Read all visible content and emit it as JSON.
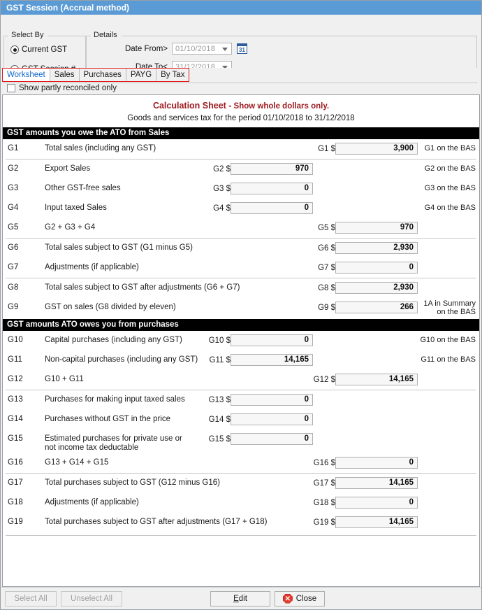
{
  "window": {
    "title": "GST Session (Accrual method)"
  },
  "select_by": {
    "legend": "Select By",
    "options": [
      {
        "label": "Current GST",
        "selected": true
      },
      {
        "label": "GST Session #",
        "selected": false
      }
    ]
  },
  "details": {
    "legend": "Details",
    "date_from": {
      "label": "Date From>",
      "value": "01/10/2018"
    },
    "date_to": {
      "label": "Date To<",
      "value": "31/12/2018"
    },
    "calendar_icon_text": "31"
  },
  "tabs": [
    {
      "label": "Worksheet",
      "active": true
    },
    {
      "label": "Sales",
      "active": false
    },
    {
      "label": "Purchases",
      "active": false
    },
    {
      "label": "PAYG",
      "active": false
    },
    {
      "label": "By Tax",
      "active": false
    }
  ],
  "filter": {
    "checkbox_label": "Show partly reconciled only",
    "checked": false
  },
  "sheet": {
    "title": "Calculation Sheet -",
    "title_note": "Show whole dollars only.",
    "subtitle": "Goods and services tax for the period 01/10/2018 to 31/12/2018",
    "section_sales": "GST amounts you owe the ATO from Sales",
    "section_purchases": "GST amounts ATO owes you from purchases"
  },
  "rows": {
    "g1": {
      "code": "G1",
      "desc": "Total sales (including any GST)",
      "field_label": "G1 $",
      "value": "3,900",
      "note": "G1 on the BAS"
    },
    "g2": {
      "code": "G2",
      "desc": "Export Sales",
      "field_label": "G2 $",
      "value": "970",
      "note": "G2 on the BAS"
    },
    "g3": {
      "code": "G3",
      "desc": "Other GST-free sales",
      "field_label": "G3 $",
      "value": "0",
      "note": "G3 on the BAS"
    },
    "g4": {
      "code": "G4",
      "desc": "Input taxed Sales",
      "field_label": "G4 $",
      "value": "0",
      "note": "G4 on the BAS"
    },
    "g5": {
      "code": "G5",
      "desc": "G2 + G3 + G4",
      "field_label": "G5 $",
      "value": "970",
      "note": ""
    },
    "g6": {
      "code": "G6",
      "desc": "Total sales subject to GST (G1 minus G5)",
      "field_label": "G6 $",
      "value": "2,930",
      "note": ""
    },
    "g7": {
      "code": "G7",
      "desc": "Adjustments (if applicable)",
      "field_label": "G7 $",
      "value": "0",
      "note": ""
    },
    "g8": {
      "code": "G8",
      "desc": "Total sales subject to GST after adjustments (G6 + G7)",
      "field_label": "G8 $",
      "value": "2,930",
      "note": ""
    },
    "g9": {
      "code": "G9",
      "desc": "GST on sales (G8 divided by eleven)",
      "field_label": "G9 $",
      "value": "266",
      "note": "1A in Summary\non the BAS"
    },
    "g10": {
      "code": "G10",
      "desc": "Capital purchases (including any GST)",
      "field_label": "G10 $",
      "value": "0",
      "note": "G10 on the BAS"
    },
    "g11": {
      "code": "G11",
      "desc": "Non-capital purchases (including any GST)",
      "field_label": "G11 $",
      "value": "14,165",
      "note": "G11 on the BAS"
    },
    "g12": {
      "code": "G12",
      "desc": "G10 + G11",
      "field_label": "G12 $",
      "value": "14,165",
      "note": ""
    },
    "g13": {
      "code": "G13",
      "desc": "Purchases for making input taxed sales",
      "field_label": "G13 $",
      "value": "0",
      "note": ""
    },
    "g14": {
      "code": "G14",
      "desc": "Purchases without GST in the price",
      "field_label": "G14 $",
      "value": "0",
      "note": ""
    },
    "g15": {
      "code": "G15",
      "desc": "Estimated purchases for private use or\nnot income tax deductable",
      "field_label": "G15 $",
      "value": "0",
      "note": ""
    },
    "g16": {
      "code": "G16",
      "desc": "G13 + G14 + G15",
      "field_label": "G16 $",
      "value": "0",
      "note": ""
    },
    "g17": {
      "code": "G17",
      "desc": "Total purchases subject to GST (G12 minus G16)",
      "field_label": "G17 $",
      "value": "14,165",
      "note": ""
    },
    "g18": {
      "code": "G18",
      "desc": "Adjustments (if applicable)",
      "field_label": "G18 $",
      "value": "0",
      "note": ""
    },
    "g19": {
      "code": "G19",
      "desc": "Total purchases subject to GST after adjustments (G17 + G18)",
      "field_label": "G19 $",
      "value": "14,165",
      "note": ""
    }
  },
  "buttons": {
    "select_all": "Select All",
    "unselect_all": "Unselect All",
    "edit": "Edit",
    "edit_accel": "E",
    "edit_rest": "dit",
    "close": "Close",
    "close_icon_glyph": "✕"
  },
  "colors": {
    "titlebar": "#5b9bd5",
    "tab_active_text": "#1569c7",
    "calc_title": "#9e1b20",
    "section_bar": "#000000",
    "tab_highlight": "#e01b1b",
    "close_red": "#e23b2e"
  }
}
